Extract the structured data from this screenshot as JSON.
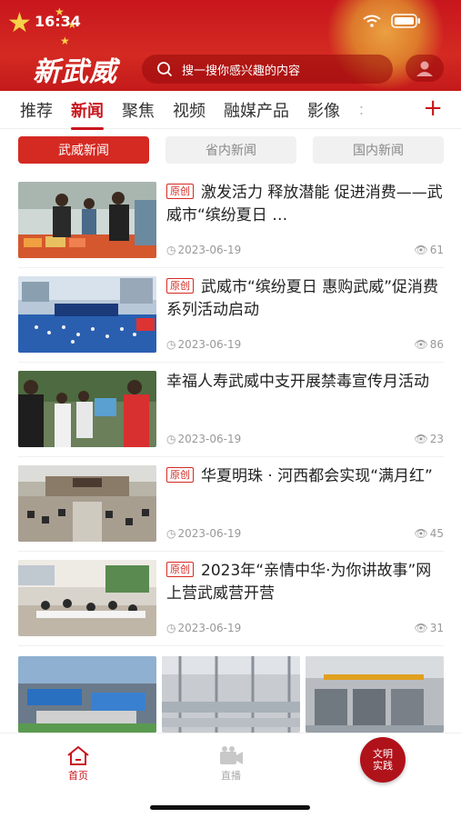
{
  "status": {
    "time": "16:34"
  },
  "header": {
    "brand": "新武威",
    "search_placeholder": "搜一搜你感兴趣的内容",
    "brand_color": "#c8161d"
  },
  "channels": [
    "推荐",
    "新闻",
    "聚焦",
    "视频",
    "融媒产品",
    "影像",
    "："
  ],
  "active_channel": "新闻",
  "subtabs": [
    "武威新闻",
    "省内新闻",
    "国内新闻"
  ],
  "news": [
    {
      "tag": "原创",
      "title": "激发活力 释放潜能 促进消费——武威市“缤纷夏日 …",
      "date": "2023-06-19",
      "views": "61"
    },
    {
      "tag": "原创",
      "title": "武威市“缤纷夏日 惠购武威”促消费系列活动启动",
      "date": "2023-06-19",
      "views": "86"
    },
    {
      "tag": "",
      "title": "幸福人寿武威中支开展禁毒宣传月活动",
      "date": "2023-06-19",
      "views": "23"
    },
    {
      "tag": "原创",
      "title": "华夏明珠 · 河西都会实现“满月红”",
      "date": "2023-06-19",
      "views": "45"
    },
    {
      "tag": "原创",
      "title": "2023年“亲情中华·为你讲故事”网上营武威营开营",
      "date": "2023-06-19",
      "views": "31"
    }
  ],
  "bottom_nav": {
    "home": "首页",
    "live": "直播",
    "civ": "文明实践"
  }
}
